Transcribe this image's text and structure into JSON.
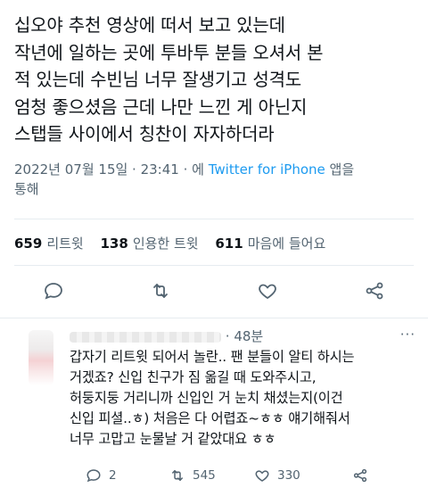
{
  "tweet": {
    "text": "십오야 추천 영상에 떠서 보고 있는데\n작년에 일하는 곳에 투바투 분들 오셔서 본\n적 있는데 수빈님 너무 잘생기고 성격도\n엄청 좋으셨음 근데 나만 느낀 게 아닌지\n스탭들 사이에서 칭찬이 자자하더라",
    "datetime": "2022년 07월 15일 · 23:41 · 에 ",
    "source": "Twitter for iPhone",
    "source_suffix": " 앱을",
    "source_line2": "통해"
  },
  "stats": {
    "retweets_count": "659",
    "retweets_label": "리트윗",
    "quotes_count": "138",
    "quotes_label": "인용한 트윗",
    "likes_count": "611",
    "likes_label": "마음에 들어요"
  },
  "actions": [
    "reply-icon",
    "retweet-icon",
    "like-icon",
    "share-icon"
  ],
  "reply": {
    "time": "· 48분",
    "more": "···",
    "text": "갑자기 리트윗 되어서 놀란.. 팬 분들이 알티 하시는\n거겠죠? 신입 친구가 짐 옮길 때 도와주시고,\n허둥지둥 거리니까 신입인 거 눈치 채셨는지(이건\n신입 피셜..ㅎ) 처음은 다 어렵죠~ㅎㅎ 얘기해줘서\n너무 고맙고 눈물날 거 같았대요 ㅎㅎ",
    "reply_count": "2",
    "retweet_count": "545",
    "like_count": "330"
  },
  "colors": {
    "accent": "#1d9bf0",
    "muted": "#536471",
    "text": "#0f1419"
  }
}
